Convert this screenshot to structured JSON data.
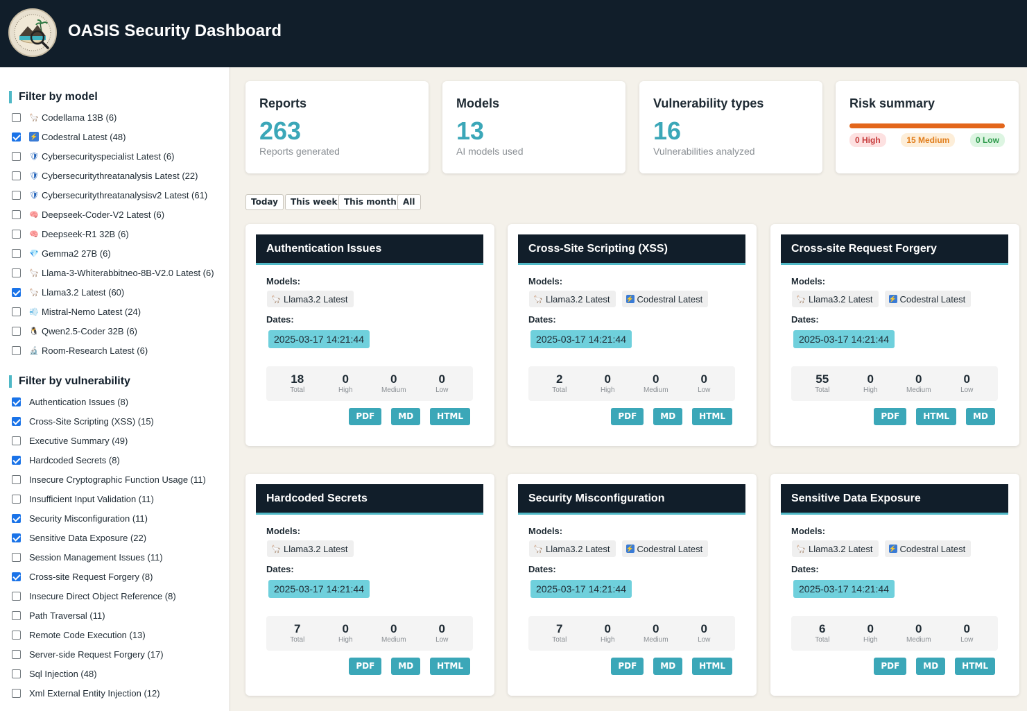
{
  "header": {
    "title": "OASIS Security Dashboard"
  },
  "sidebar": {
    "model_title": "Filter by model",
    "models": [
      {
        "label": "Codellama 13B (6)",
        "checked": false,
        "icon": "llama-icon"
      },
      {
        "label": "Codestral Latest (48)",
        "checked": true,
        "icon": "lightning-icon"
      },
      {
        "label": "Cybersecurityspecialist Latest (6)",
        "checked": false,
        "icon": "shield-icon"
      },
      {
        "label": "Cybersecuritythreatanalysis Latest (22)",
        "checked": false,
        "icon": "shield-icon"
      },
      {
        "label": "Cybersecuritythreatanalysisv2 Latest (61)",
        "checked": false,
        "icon": "shield-icon"
      },
      {
        "label": "Deepseek-Coder-V2 Latest (6)",
        "checked": false,
        "icon": "brain-icon"
      },
      {
        "label": "Deepseek-R1 32B (6)",
        "checked": false,
        "icon": "brain-icon"
      },
      {
        "label": "Gemma2 27B (6)",
        "checked": false,
        "icon": "gem-icon"
      },
      {
        "label": "Llama-3-Whiterabbitneo-8B-V2.0 Latest (6)",
        "checked": false,
        "icon": "llama-icon"
      },
      {
        "label": "Llama3.2 Latest (60)",
        "checked": true,
        "icon": "llama-icon"
      },
      {
        "label": "Mistral-Nemo Latest (24)",
        "checked": false,
        "icon": "wind-icon"
      },
      {
        "label": "Qwen2.5-Coder 32B (6)",
        "checked": false,
        "icon": "penguin-icon"
      },
      {
        "label": "Room-Research Latest (6)",
        "checked": false,
        "icon": "microscope-icon"
      }
    ],
    "vuln_title": "Filter by vulnerability",
    "vulns": [
      {
        "label": "Authentication Issues (8)",
        "checked": true
      },
      {
        "label": "Cross-Site Scripting (XSS) (15)",
        "checked": true
      },
      {
        "label": "Executive Summary (49)",
        "checked": false
      },
      {
        "label": "Hardcoded Secrets (8)",
        "checked": true
      },
      {
        "label": "Insecure Cryptographic Function Usage (11)",
        "checked": false
      },
      {
        "label": "Insufficient Input Validation (11)",
        "checked": false
      },
      {
        "label": "Security Misconfiguration (11)",
        "checked": true
      },
      {
        "label": "Sensitive Data Exposure (22)",
        "checked": true
      },
      {
        "label": "Session Management Issues (11)",
        "checked": false
      },
      {
        "label": "Cross-site Request Forgery (8)",
        "checked": true
      },
      {
        "label": "Insecure Direct Object Reference (8)",
        "checked": false
      },
      {
        "label": "Path Traversal (11)",
        "checked": false
      },
      {
        "label": "Remote Code Execution (13)",
        "checked": false
      },
      {
        "label": "Server-side Request Forgery (17)",
        "checked": false
      },
      {
        "label": "Sql Injection (48)",
        "checked": false
      },
      {
        "label": "Xml External Entity Injection (12)",
        "checked": false
      }
    ]
  },
  "stats": {
    "reports": {
      "title": "Reports",
      "value": "263",
      "sub": "Reports generated"
    },
    "models": {
      "title": "Models",
      "value": "13",
      "sub": "AI models used"
    },
    "vulns": {
      "title": "Vulnerability types",
      "value": "16",
      "sub": "Vulnerabilities analyzed"
    },
    "risk": {
      "title": "Risk summary",
      "high": "0 High",
      "medium": "15 Medium",
      "low": "0 Low"
    }
  },
  "time_filters": [
    "Today",
    "This week",
    "This month",
    "All"
  ],
  "cards_common": {
    "models_label": "Models:",
    "dates_label": "Dates:",
    "total_label": "Total",
    "high_label": "High",
    "medium_label": "Medium",
    "low_label": "Low"
  },
  "cards": [
    {
      "title": "Authentication Issues",
      "models": [
        "Llama3.2 Latest"
      ],
      "date": "2025-03-17 14:21:44",
      "total": "18",
      "high": "0",
      "medium": "0",
      "low": "0",
      "formats": [
        "PDF",
        "MD",
        "HTML"
      ]
    },
    {
      "title": "Cross-Site Scripting (XSS)",
      "models": [
        "Llama3.2 Latest",
        "Codestral Latest"
      ],
      "date": "2025-03-17 14:21:44",
      "total": "2",
      "high": "0",
      "medium": "0",
      "low": "0",
      "formats": [
        "PDF",
        "MD",
        "HTML"
      ]
    },
    {
      "title": "Cross-site Request Forgery",
      "models": [
        "Llama3.2 Latest",
        "Codestral Latest"
      ],
      "date": "2025-03-17 14:21:44",
      "total": "55",
      "high": "0",
      "medium": "0",
      "low": "0",
      "formats": [
        "PDF",
        "HTML",
        "MD"
      ]
    },
    {
      "title": "Hardcoded Secrets",
      "models": [
        "Llama3.2 Latest"
      ],
      "date": "2025-03-17 14:21:44",
      "total": "7",
      "high": "0",
      "medium": "0",
      "low": "0",
      "formats": [
        "PDF",
        "MD",
        "HTML"
      ]
    },
    {
      "title": "Security Misconfiguration",
      "models": [
        "Llama3.2 Latest",
        "Codestral Latest"
      ],
      "date": "2025-03-17 14:21:44",
      "total": "7",
      "high": "0",
      "medium": "0",
      "low": "0",
      "formats": [
        "PDF",
        "MD",
        "HTML"
      ]
    },
    {
      "title": "Sensitive Data Exposure",
      "models": [
        "Llama3.2 Latest",
        "Codestral Latest"
      ],
      "date": "2025-03-17 14:21:44",
      "total": "6",
      "high": "0",
      "medium": "0",
      "low": "0",
      "formats": [
        "PDF",
        "MD",
        "HTML"
      ]
    }
  ]
}
